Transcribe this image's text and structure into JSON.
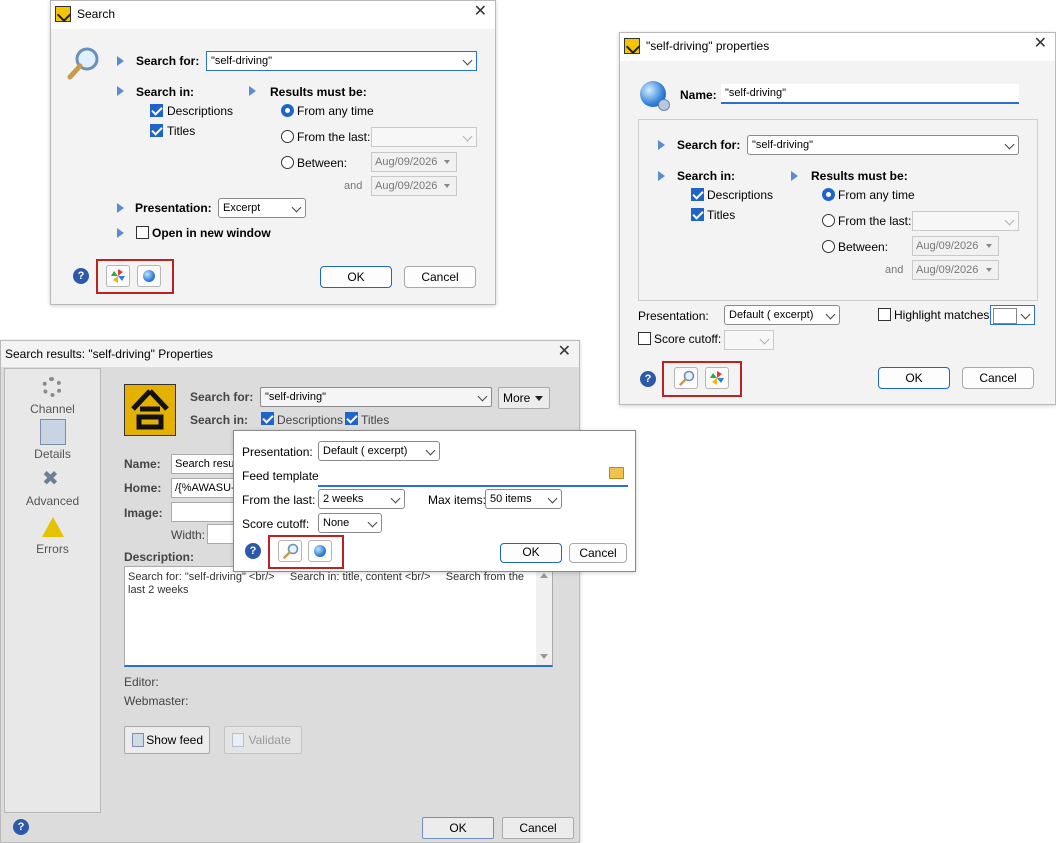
{
  "search_dialog": {
    "title": "Search",
    "search_for_label": "Search for:",
    "search_for_value": "\"self-driving\"",
    "search_in_label": "Search in:",
    "descriptions_label": "Descriptions",
    "titles_label": "Titles",
    "results_label": "Results must be:",
    "from_any_time": "From any time",
    "from_the_last": "From the last:",
    "between": "Between:",
    "and": "and",
    "date1": "Aug/09/2026",
    "date2": "Aug/09/2026",
    "presentation_label": "Presentation:",
    "presentation_value": "Excerpt",
    "open_new_window": "Open in new window",
    "ok": "OK",
    "cancel": "Cancel"
  },
  "props_dialog": {
    "title": "\"self-driving\" properties",
    "name_label": "Name:",
    "name_value": "\"self-driving\"",
    "search_for_label": "Search for:",
    "search_for_value": "\"self-driving\"",
    "search_in_label": "Search in:",
    "descriptions_label": "Descriptions",
    "titles_label": "Titles",
    "results_label": "Results must be:",
    "from_any_time": "From any time",
    "from_the_last": "From the last:",
    "between": "Between:",
    "and": "and",
    "date1": "Aug/09/2026",
    "date2": "Aug/09/2026",
    "presentation_label": "Presentation:",
    "presentation_value": "Default ( excerpt)",
    "highlight_label": "Highlight matches:",
    "score_cutoff_label": "Score cutoff:",
    "ok": "OK",
    "cancel": "Cancel"
  },
  "results_dialog": {
    "title": "Search results: \"self-driving\" Properties",
    "sidebar": [
      {
        "label": "Channel",
        "icon": "gear-icon"
      },
      {
        "label": "Details",
        "icon": "details-icon"
      },
      {
        "label": "Advanced",
        "icon": "tools-icon"
      },
      {
        "label": "Errors",
        "icon": "warning-icon"
      }
    ],
    "search_for_label": "Search for:",
    "search_for_value": "\"self-driving\"",
    "more_label": "More",
    "search_in_label": "Search in:",
    "descriptions_label": "Descriptions",
    "titles_label": "Titles",
    "name_label": "Name:",
    "name_value": "Search result",
    "home_label": "Home:",
    "home_value": "/{%AWASU-",
    "image_label": "Image:",
    "width_label": "Width:",
    "description_label": "Description:",
    "description_text": "Search for: \"self-driving\" <br/>     Search in: title, content <br/>     Search from the last 2 weeks",
    "editor_label": "Editor:",
    "webmaster_label": "Webmaster:",
    "show_feed": "Show feed",
    "validate": "Validate",
    "ok": "OK",
    "cancel": "Cancel"
  },
  "popup": {
    "presentation_label": "Presentation:",
    "presentation_value": "Default ( excerpt)",
    "feed_template_label": "Feed template:",
    "from_the_last_label": "From the last:",
    "from_the_last_value": "2 weeks",
    "max_items_label": "Max items:",
    "max_items_value": "50 items",
    "score_cutoff_label": "Score cutoff:",
    "score_cutoff_value": "None",
    "ok": "OK",
    "cancel": "Cancel"
  }
}
